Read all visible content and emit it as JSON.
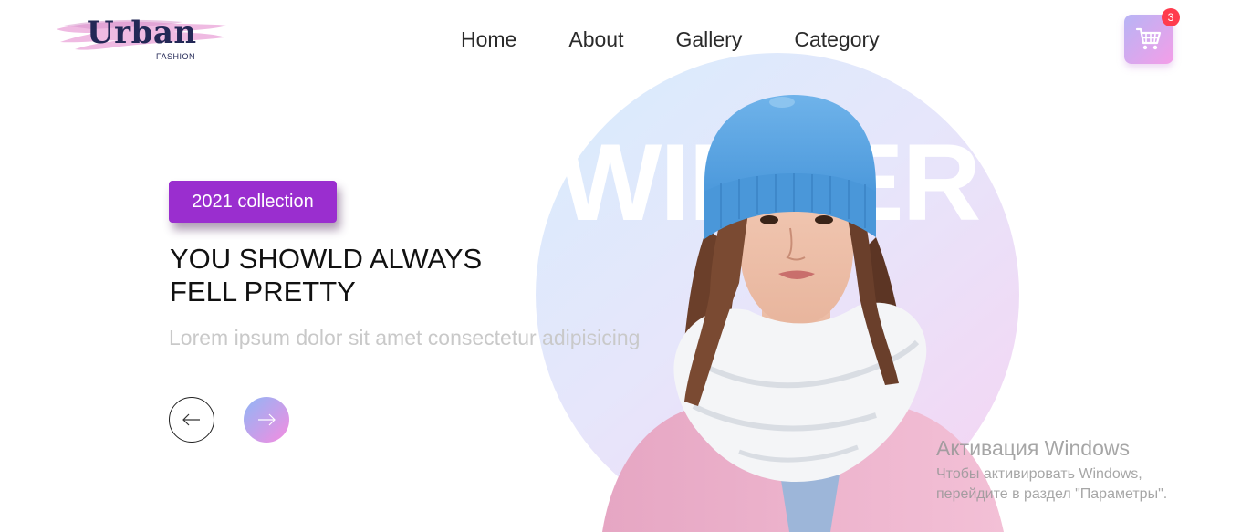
{
  "logo": {
    "word": "Urban",
    "sub": "FASHION"
  },
  "nav": {
    "items": [
      "Home",
      "About",
      "Gallery",
      "Category"
    ]
  },
  "cart": {
    "icon": "cart-icon",
    "count": "3"
  },
  "hero": {
    "badge": "2021 collection",
    "headline_line1": "YOU SHOWLD ALWAYS",
    "headline_line2": "FELL PRETTY",
    "text": "Lorem ipsum dolor sit amet consectetur adipisicing",
    "big_word": "WINTER",
    "prev_icon": "arrow-left-icon",
    "next_icon": "arrow-right-icon"
  },
  "windows_activation": {
    "title": "Активация Windows",
    "line1": "Чтобы активировать Windows,",
    "line2": "перейдите в раздел \"Параметры\"."
  },
  "colors": {
    "accent": "#9a2ecf",
    "gradient_start": "#8fb6f6",
    "gradient_end": "#f58ce0",
    "badge_red": "#ff3b4e",
    "logo_navy": "#232856"
  }
}
